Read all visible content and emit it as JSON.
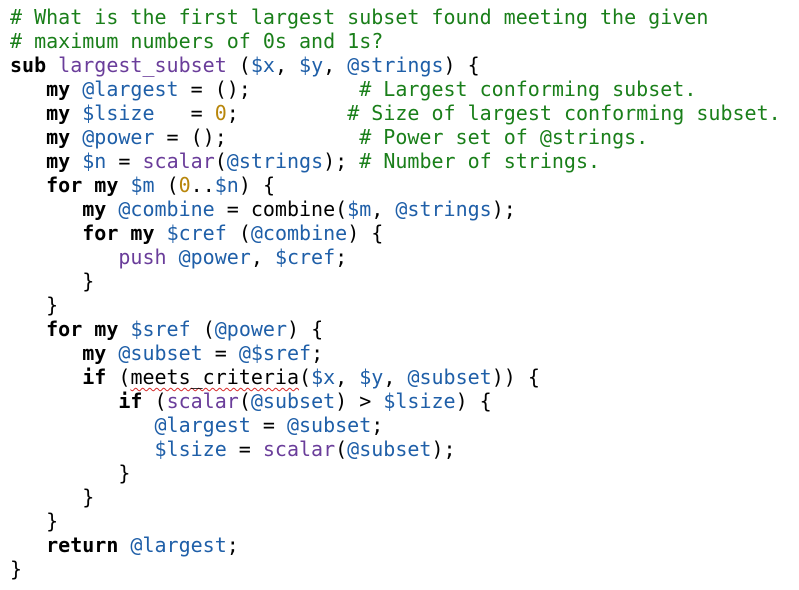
{
  "colors": {
    "background": "#ffffff",
    "comment": "#1a7f1a",
    "keyword": "#000000",
    "variable": "#1f5fa8",
    "function": "#6a3d9a",
    "number": "#b8860b",
    "spell_error_underline": "#d62828"
  },
  "code": {
    "lines": [
      [
        {
          "t": "comment",
          "v": "# What is the first largest subset found meeting the given"
        }
      ],
      [
        {
          "t": "comment",
          "v": "# maximum numbers of 0s and 1s?"
        }
      ],
      [
        {
          "t": "keyword",
          "v": "sub"
        },
        {
          "t": "plain",
          "v": " "
        },
        {
          "t": "func",
          "v": "largest_subset"
        },
        {
          "t": "plain",
          "v": " ("
        },
        {
          "t": "var",
          "v": "$x"
        },
        {
          "t": "plain",
          "v": ", "
        },
        {
          "t": "var",
          "v": "$y"
        },
        {
          "t": "plain",
          "v": ", "
        },
        {
          "t": "var",
          "v": "@strings"
        },
        {
          "t": "plain",
          "v": ") {"
        }
      ],
      [
        {
          "t": "plain",
          "v": "   "
        },
        {
          "t": "keyword",
          "v": "my"
        },
        {
          "t": "plain",
          "v": " "
        },
        {
          "t": "var",
          "v": "@largest"
        },
        {
          "t": "plain",
          "v": " = ();         "
        },
        {
          "t": "comment",
          "v": "# Largest conforming subset."
        }
      ],
      [
        {
          "t": "plain",
          "v": "   "
        },
        {
          "t": "keyword",
          "v": "my"
        },
        {
          "t": "plain",
          "v": " "
        },
        {
          "t": "var",
          "v": "$lsize"
        },
        {
          "t": "plain",
          "v": "   = "
        },
        {
          "t": "number",
          "v": "0"
        },
        {
          "t": "plain",
          "v": ";         "
        },
        {
          "t": "comment",
          "v": "# Size of largest conforming subset."
        }
      ],
      [
        {
          "t": "plain",
          "v": "   "
        },
        {
          "t": "keyword",
          "v": "my"
        },
        {
          "t": "plain",
          "v": " "
        },
        {
          "t": "var",
          "v": "@power"
        },
        {
          "t": "plain",
          "v": " = ();           "
        },
        {
          "t": "comment",
          "v": "# Power set of @strings."
        }
      ],
      [
        {
          "t": "plain",
          "v": "   "
        },
        {
          "t": "keyword",
          "v": "my"
        },
        {
          "t": "plain",
          "v": " "
        },
        {
          "t": "var",
          "v": "$n"
        },
        {
          "t": "plain",
          "v": " = "
        },
        {
          "t": "func",
          "v": "scalar"
        },
        {
          "t": "plain",
          "v": "("
        },
        {
          "t": "var",
          "v": "@strings"
        },
        {
          "t": "plain",
          "v": "); "
        },
        {
          "t": "comment",
          "v": "# Number of strings."
        }
      ],
      [
        {
          "t": "plain",
          "v": "   "
        },
        {
          "t": "keyword",
          "v": "for"
        },
        {
          "t": "plain",
          "v": " "
        },
        {
          "t": "keyword",
          "v": "my"
        },
        {
          "t": "plain",
          "v": " "
        },
        {
          "t": "var",
          "v": "$m"
        },
        {
          "t": "plain",
          "v": " ("
        },
        {
          "t": "number",
          "v": "0"
        },
        {
          "t": "plain",
          "v": ".."
        },
        {
          "t": "var",
          "v": "$n"
        },
        {
          "t": "plain",
          "v": ") {"
        }
      ],
      [
        {
          "t": "plain",
          "v": "      "
        },
        {
          "t": "keyword",
          "v": "my"
        },
        {
          "t": "plain",
          "v": " "
        },
        {
          "t": "var",
          "v": "@combine"
        },
        {
          "t": "plain",
          "v": " = combine("
        },
        {
          "t": "var",
          "v": "$m"
        },
        {
          "t": "plain",
          "v": ", "
        },
        {
          "t": "var",
          "v": "@strings"
        },
        {
          "t": "plain",
          "v": ");"
        }
      ],
      [
        {
          "t": "plain",
          "v": "      "
        },
        {
          "t": "keyword",
          "v": "for"
        },
        {
          "t": "plain",
          "v": " "
        },
        {
          "t": "keyword",
          "v": "my"
        },
        {
          "t": "plain",
          "v": " "
        },
        {
          "t": "var",
          "v": "$cref"
        },
        {
          "t": "plain",
          "v": " ("
        },
        {
          "t": "var",
          "v": "@combine"
        },
        {
          "t": "plain",
          "v": ") {"
        }
      ],
      [
        {
          "t": "plain",
          "v": "         "
        },
        {
          "t": "func",
          "v": "push"
        },
        {
          "t": "plain",
          "v": " "
        },
        {
          "t": "var",
          "v": "@power"
        },
        {
          "t": "plain",
          "v": ", "
        },
        {
          "t": "var",
          "v": "$cref"
        },
        {
          "t": "plain",
          "v": ";"
        }
      ],
      [
        {
          "t": "plain",
          "v": "      }"
        }
      ],
      [
        {
          "t": "plain",
          "v": "   }"
        }
      ],
      [
        {
          "t": "plain",
          "v": "   "
        },
        {
          "t": "keyword",
          "v": "for"
        },
        {
          "t": "plain",
          "v": " "
        },
        {
          "t": "keyword",
          "v": "my"
        },
        {
          "t": "plain",
          "v": " "
        },
        {
          "t": "var",
          "v": "$sref"
        },
        {
          "t": "plain",
          "v": " ("
        },
        {
          "t": "var",
          "v": "@power"
        },
        {
          "t": "plain",
          "v": ") {"
        }
      ],
      [
        {
          "t": "plain",
          "v": "      "
        },
        {
          "t": "keyword",
          "v": "my"
        },
        {
          "t": "plain",
          "v": " "
        },
        {
          "t": "var",
          "v": "@subset"
        },
        {
          "t": "plain",
          "v": " = "
        },
        {
          "t": "var",
          "v": "@$sref"
        },
        {
          "t": "plain",
          "v": ";"
        }
      ],
      [
        {
          "t": "plain",
          "v": "      "
        },
        {
          "t": "keyword",
          "v": "if"
        },
        {
          "t": "plain",
          "v": " ("
        },
        {
          "t": "spell",
          "v": "meets_criteria"
        },
        {
          "t": "plain",
          "v": "("
        },
        {
          "t": "var",
          "v": "$x"
        },
        {
          "t": "plain",
          "v": ", "
        },
        {
          "t": "var",
          "v": "$y"
        },
        {
          "t": "plain",
          "v": ", "
        },
        {
          "t": "var",
          "v": "@subset"
        },
        {
          "t": "plain",
          "v": ")) {"
        }
      ],
      [
        {
          "t": "plain",
          "v": "         "
        },
        {
          "t": "keyword",
          "v": "if"
        },
        {
          "t": "plain",
          "v": " ("
        },
        {
          "t": "func",
          "v": "scalar"
        },
        {
          "t": "plain",
          "v": "("
        },
        {
          "t": "var",
          "v": "@subset"
        },
        {
          "t": "plain",
          "v": ") > "
        },
        {
          "t": "var",
          "v": "$lsize"
        },
        {
          "t": "plain",
          "v": ") {"
        }
      ],
      [
        {
          "t": "plain",
          "v": "            "
        },
        {
          "t": "var",
          "v": "@largest"
        },
        {
          "t": "plain",
          "v": " = "
        },
        {
          "t": "var",
          "v": "@subset"
        },
        {
          "t": "plain",
          "v": ";"
        }
      ],
      [
        {
          "t": "plain",
          "v": "            "
        },
        {
          "t": "var",
          "v": "$lsize"
        },
        {
          "t": "plain",
          "v": " = "
        },
        {
          "t": "func",
          "v": "scalar"
        },
        {
          "t": "plain",
          "v": "("
        },
        {
          "t": "var",
          "v": "@subset"
        },
        {
          "t": "plain",
          "v": ");"
        }
      ],
      [
        {
          "t": "plain",
          "v": "         }"
        }
      ],
      [
        {
          "t": "plain",
          "v": "      }"
        }
      ],
      [
        {
          "t": "plain",
          "v": "   }"
        }
      ],
      [
        {
          "t": "plain",
          "v": "   "
        },
        {
          "t": "keyword",
          "v": "return"
        },
        {
          "t": "plain",
          "v": " "
        },
        {
          "t": "var",
          "v": "@largest"
        },
        {
          "t": "plain",
          "v": ";"
        }
      ],
      [
        {
          "t": "plain",
          "v": "}"
        }
      ]
    ]
  }
}
